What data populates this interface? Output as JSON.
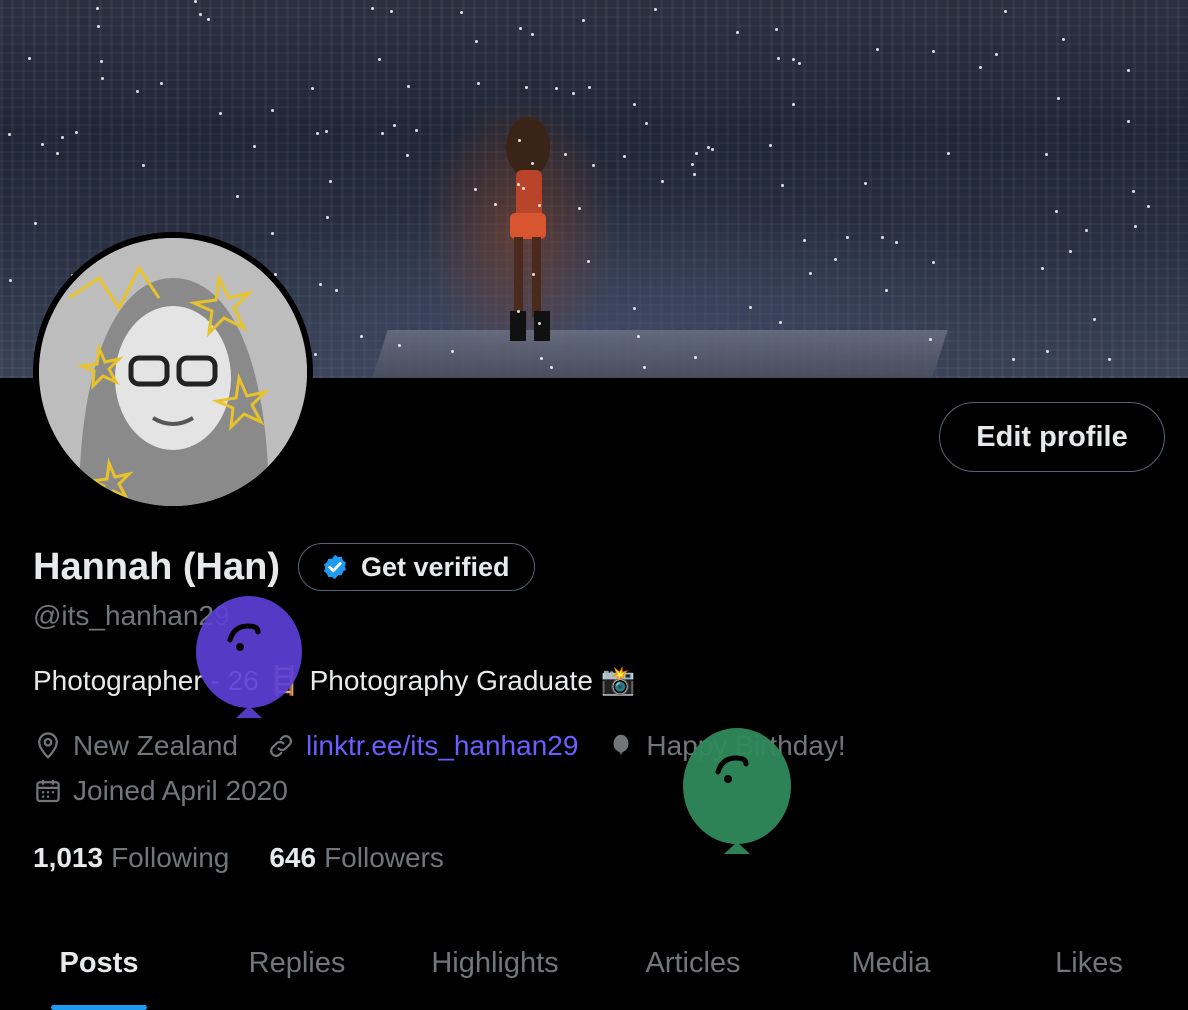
{
  "profile": {
    "name": "Hannah (Han)",
    "handle": "@its_hanhan29",
    "verify_label": "Get verified",
    "edit_label": "Edit profile",
    "bio_part1": "Photographer - 26",
    "bio_emoji1": "🪜",
    "bio_part2": "Photography Graduate",
    "bio_emoji2": "📸",
    "location": "New Zealand",
    "link": "linktr.ee/its_hanhan29",
    "birthday": "Happy Birthday!",
    "joined": "Joined April 2020",
    "following_count": "1,013",
    "following_label": "Following",
    "followers_count": "646",
    "followers_label": "Followers"
  },
  "tabs": [
    {
      "label": "Posts"
    },
    {
      "label": "Replies"
    },
    {
      "label": "Highlights"
    },
    {
      "label": "Articles"
    },
    {
      "label": "Media"
    },
    {
      "label": "Likes"
    }
  ],
  "colors": {
    "accent": "#1d9bf0",
    "link": "#6c5dff",
    "balloon_purple": "#5b3fd6",
    "balloon_green": "#2f8a5a"
  }
}
